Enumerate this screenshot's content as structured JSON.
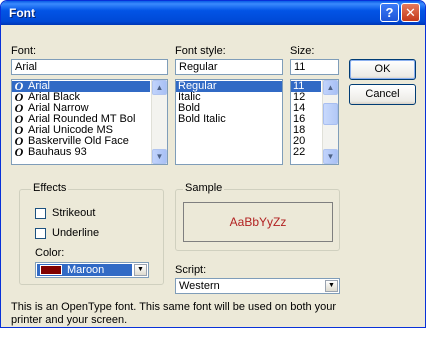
{
  "window": {
    "title": "Font",
    "help_glyph": "?",
    "close_glyph": "✕"
  },
  "font": {
    "label": "Font:",
    "value": "Arial",
    "items": [
      "Arial",
      "Arial Black",
      "Arial Narrow",
      "Arial Rounded MT Bol",
      "Arial Unicode MS",
      "Baskerville Old Face",
      "Bauhaus 93"
    ],
    "selected": "Arial",
    "type_glyph": "O"
  },
  "style": {
    "label": "Font style:",
    "value": "Regular",
    "items": [
      "Regular",
      "Italic",
      "Bold",
      "Bold Italic"
    ],
    "selected": "Regular"
  },
  "size": {
    "label": "Size:",
    "value": "11",
    "items": [
      "11",
      "12",
      "14",
      "16",
      "18",
      "20",
      "22"
    ],
    "selected": "11"
  },
  "buttons": {
    "ok": "OK",
    "cancel": "Cancel"
  },
  "effects": {
    "label": "Effects",
    "strikeout": "Strikeout",
    "underline": "Underline",
    "color_label": "Color:",
    "color_value": "Maroon",
    "color_hex": "#800000"
  },
  "sample": {
    "label": "Sample",
    "text": "AaBbYyZz",
    "text_color": "#b22222"
  },
  "script": {
    "label": "Script:",
    "value": "Western"
  },
  "description": {
    "line1": "This is an OpenType font. This same font will be used on both your",
    "line2": "printer and your screen."
  },
  "colors": {
    "selection": "#316ac5",
    "dialog_bg": "#ece9d8",
    "titlebar": "#0254e6"
  }
}
